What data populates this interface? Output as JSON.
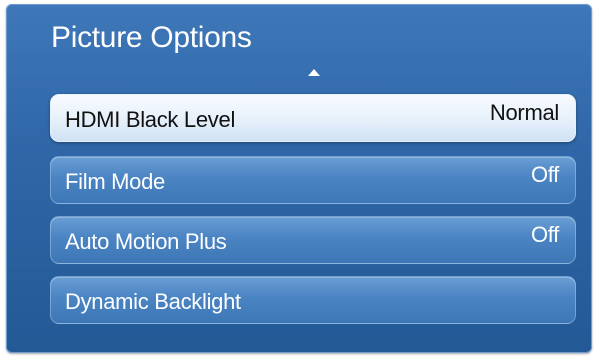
{
  "panel": {
    "title": "Picture Options",
    "scroll_up_icon": "triangle-up-icon",
    "items": [
      {
        "label": "HDMI Black Level",
        "value": "Normal",
        "selected": true
      },
      {
        "label": "Film Mode",
        "value": "Off",
        "selected": false
      },
      {
        "label": "Auto Motion Plus",
        "value": "Off",
        "selected": false
      },
      {
        "label": "Dynamic Backlight",
        "value": "",
        "selected": false
      }
    ]
  },
  "colors": {
    "panel_background": "#2f67a8",
    "item_background": "#4a84c3",
    "selected_background": "#e8f1fb",
    "text_light": "#ffffff",
    "text_dark": "#111111"
  }
}
